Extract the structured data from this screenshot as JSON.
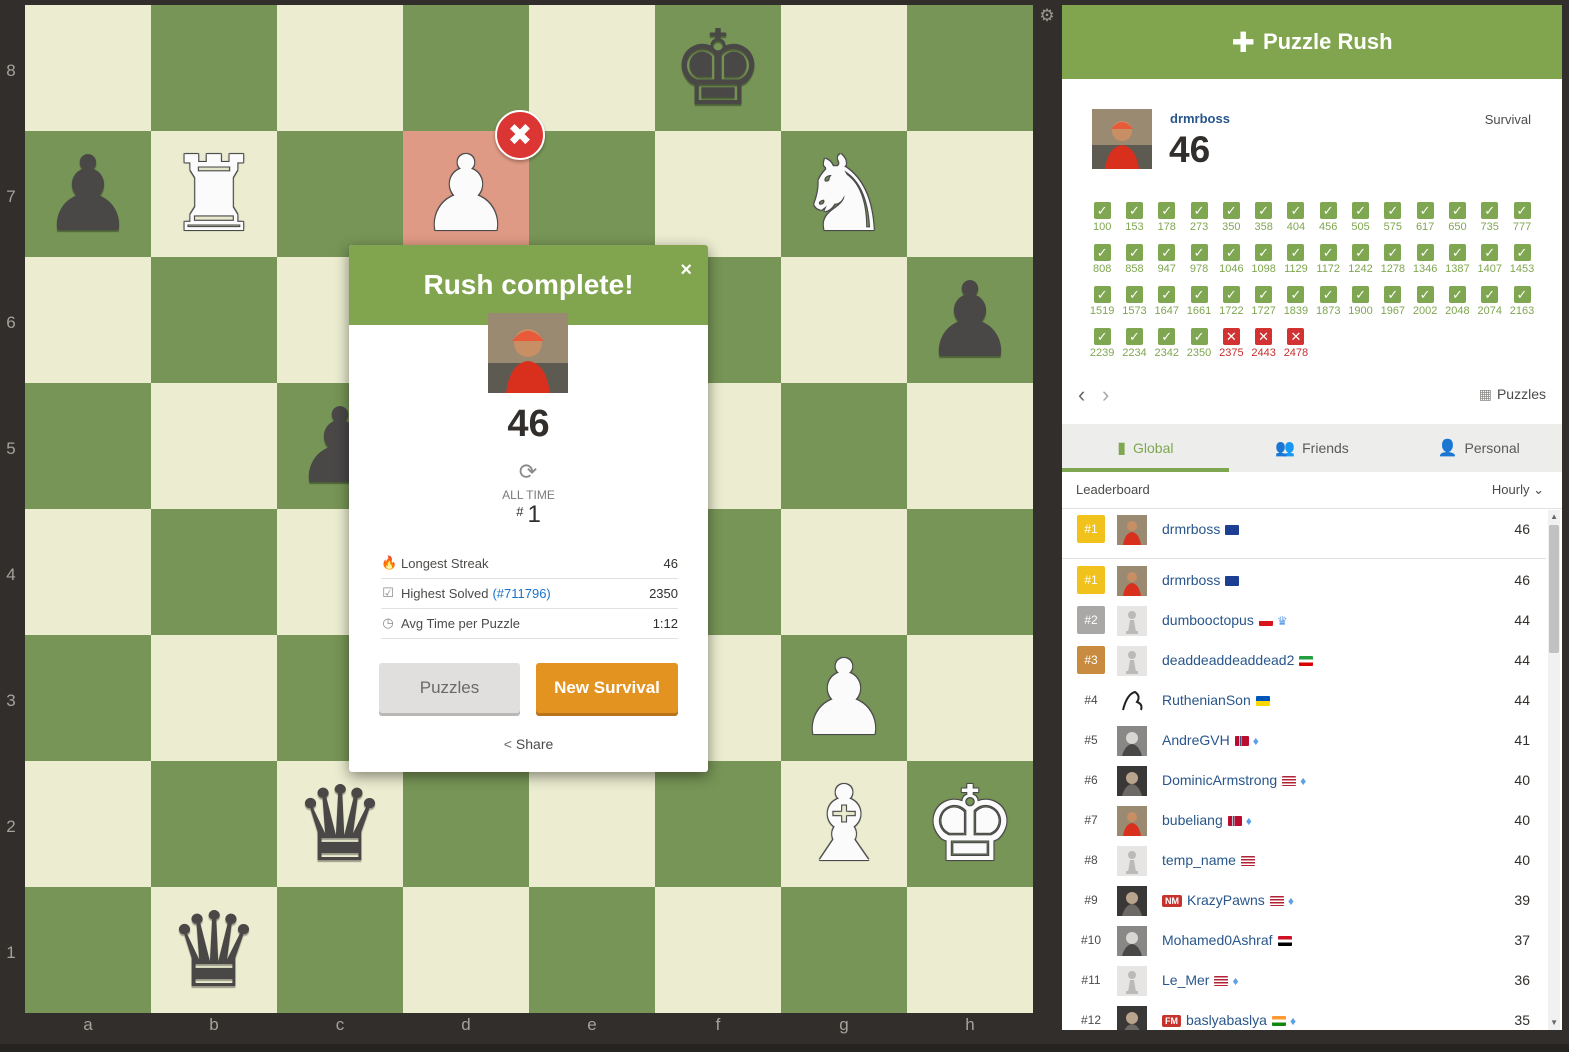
{
  "board": {
    "files": [
      "a",
      "b",
      "c",
      "d",
      "e",
      "f",
      "g",
      "h"
    ],
    "ranks": [
      "8",
      "7",
      "6",
      "5",
      "4",
      "3",
      "2",
      "1"
    ],
    "pieces": [
      {
        "square": "f8",
        "glyph": "♚",
        "color": "black",
        "name": "black-king-icon"
      },
      {
        "square": "a7",
        "glyph": "♟",
        "color": "black",
        "name": "black-pawn-icon"
      },
      {
        "square": "b7",
        "glyph": "♜",
        "color": "white",
        "name": "white-rook-icon"
      },
      {
        "square": "d7",
        "glyph": "♟",
        "color": "white",
        "name": "white-pawn-icon"
      },
      {
        "square": "g7",
        "glyph": "♞",
        "color": "white",
        "name": "white-knight-icon"
      },
      {
        "square": "h6",
        "glyph": "♟",
        "color": "black",
        "name": "black-pawn-icon"
      },
      {
        "square": "c5",
        "glyph": "♟",
        "color": "black",
        "name": "black-pawn-icon"
      },
      {
        "square": "g3",
        "glyph": "♟",
        "color": "white",
        "name": "white-pawn-icon"
      },
      {
        "square": "c2",
        "glyph": "♛",
        "color": "black",
        "name": "black-queen-icon"
      },
      {
        "square": "g2",
        "glyph": "♝",
        "color": "white",
        "name": "white-bishop-icon"
      },
      {
        "square": "h2",
        "glyph": "♚",
        "color": "white",
        "name": "white-king-icon"
      },
      {
        "square": "b1",
        "glyph": "♛",
        "color": "black",
        "name": "black-queen-icon"
      }
    ],
    "highlight_square": "d7",
    "wrong_marker": "✖"
  },
  "modal": {
    "title": "Rush complete!",
    "close": "×",
    "score": "46",
    "alltime_label": "ALL TIME",
    "rank_hash": "#",
    "rank": "1",
    "stats": [
      {
        "icon": "🔥",
        "label": "Longest Streak",
        "link": "",
        "value": "46"
      },
      {
        "icon": "☑",
        "label": "Highest Solved",
        "link": "(#711796)",
        "value": "2350"
      },
      {
        "icon": "◷",
        "label": "Avg Time per Puzzle",
        "link": "",
        "value": "1:12"
      }
    ],
    "puzzles_button": "Puzzles",
    "new_survival_button": "New Survival",
    "share_label": "Share"
  },
  "sidebar": {
    "title": "Puzzle Rush",
    "player": {
      "name": "drmrboss",
      "score": "46",
      "mode": "Survival"
    },
    "attempts": [
      {
        "n": "100",
        "ok": true
      },
      {
        "n": "153",
        "ok": true
      },
      {
        "n": "178",
        "ok": true
      },
      {
        "n": "273",
        "ok": true
      },
      {
        "n": "350",
        "ok": true
      },
      {
        "n": "358",
        "ok": true
      },
      {
        "n": "404",
        "ok": true
      },
      {
        "n": "456",
        "ok": true
      },
      {
        "n": "505",
        "ok": true
      },
      {
        "n": "575",
        "ok": true
      },
      {
        "n": "617",
        "ok": true
      },
      {
        "n": "650",
        "ok": true
      },
      {
        "n": "735",
        "ok": true
      },
      {
        "n": "777",
        "ok": true
      },
      {
        "n": "808",
        "ok": true
      },
      {
        "n": "858",
        "ok": true
      },
      {
        "n": "947",
        "ok": true
      },
      {
        "n": "978",
        "ok": true
      },
      {
        "n": "1046",
        "ok": true
      },
      {
        "n": "1098",
        "ok": true
      },
      {
        "n": "1129",
        "ok": true
      },
      {
        "n": "1172",
        "ok": true
      },
      {
        "n": "1242",
        "ok": true
      },
      {
        "n": "1278",
        "ok": true
      },
      {
        "n": "1346",
        "ok": true
      },
      {
        "n": "1387",
        "ok": true
      },
      {
        "n": "1407",
        "ok": true
      },
      {
        "n": "1453",
        "ok": true
      },
      {
        "n": "1519",
        "ok": true
      },
      {
        "n": "1573",
        "ok": true
      },
      {
        "n": "1647",
        "ok": true
      },
      {
        "n": "1661",
        "ok": true
      },
      {
        "n": "1722",
        "ok": true
      },
      {
        "n": "1727",
        "ok": true
      },
      {
        "n": "1839",
        "ok": true
      },
      {
        "n": "1873",
        "ok": true
      },
      {
        "n": "1900",
        "ok": true
      },
      {
        "n": "1967",
        "ok": true
      },
      {
        "n": "2002",
        "ok": true
      },
      {
        "n": "2048",
        "ok": true
      },
      {
        "n": "2074",
        "ok": true
      },
      {
        "n": "2163",
        "ok": true
      },
      {
        "n": "2239",
        "ok": true
      },
      {
        "n": "2234",
        "ok": true
      },
      {
        "n": "2342",
        "ok": true
      },
      {
        "n": "2350",
        "ok": true
      },
      {
        "n": "2375",
        "ok": false
      },
      {
        "n": "2443",
        "ok": false
      },
      {
        "n": "2478",
        "ok": false
      }
    ],
    "puzzles_link": "Puzzles",
    "tabs": [
      {
        "label": "Global",
        "icon": "▮",
        "active": true
      },
      {
        "label": "Friends",
        "icon": "👥",
        "active": false
      },
      {
        "label": "Personal",
        "icon": "👤",
        "active": false
      }
    ],
    "leaderboard_title": "Leaderboard",
    "period": "Hourly",
    "mine": {
      "rank": "#1",
      "name": "drmrboss",
      "flag": "au",
      "extra": "",
      "score": "46",
      "avatar": "red"
    },
    "rows": [
      {
        "rank": "#1",
        "medal": "gold",
        "name": "drmrboss",
        "title": "",
        "flag": "au",
        "extra": "",
        "score": "46",
        "avatar": "red"
      },
      {
        "rank": "#2",
        "medal": "silver",
        "name": "dumbooctopus",
        "title": "",
        "flag": "cz",
        "extra": "♛",
        "score": "44",
        "avatar": "pawn"
      },
      {
        "rank": "#3",
        "medal": "bronze",
        "name": "deaddeaddeaddead2",
        "title": "",
        "flag": "ir",
        "extra": "",
        "score": "44",
        "avatar": "pawn"
      },
      {
        "rank": "#4",
        "medal": "",
        "name": "RuthenianSon",
        "title": "",
        "flag": "ua",
        "extra": "",
        "score": "44",
        "avatar": "sketch"
      },
      {
        "rank": "#5",
        "medal": "",
        "name": "AndreGVH",
        "title": "",
        "flag": "no",
        "extra": "♦",
        "score": "41",
        "avatar": "gray"
      },
      {
        "rank": "#6",
        "medal": "",
        "name": "DominicArmstrong",
        "title": "",
        "flag": "us",
        "extra": "♦",
        "score": "40",
        "avatar": "dark"
      },
      {
        "rank": "#7",
        "medal": "",
        "name": "bubeliang",
        "title": "",
        "flag": "no",
        "extra": "♦",
        "score": "40",
        "avatar": "red"
      },
      {
        "rank": "#8",
        "medal": "",
        "name": "temp_name",
        "title": "",
        "flag": "us",
        "extra": "",
        "score": "40",
        "avatar": "pawn"
      },
      {
        "rank": "#9",
        "medal": "",
        "name": "KrazyPawns",
        "title": "NM",
        "flag": "us",
        "extra": "♦",
        "score": "39",
        "avatar": "dark"
      },
      {
        "rank": "#10",
        "medal": "",
        "name": "Mohamed0Ashraf",
        "title": "",
        "flag": "eg",
        "extra": "",
        "score": "37",
        "avatar": "gray"
      },
      {
        "rank": "#11",
        "medal": "",
        "name": "Le_Mer",
        "title": "",
        "flag": "us",
        "extra": "♦",
        "score": "36",
        "avatar": "pawn"
      },
      {
        "rank": "#12",
        "medal": "",
        "name": "baslyabaslya",
        "title": "FM",
        "flag": "in",
        "extra": "♦",
        "score": "35",
        "avatar": "dark"
      }
    ]
  }
}
